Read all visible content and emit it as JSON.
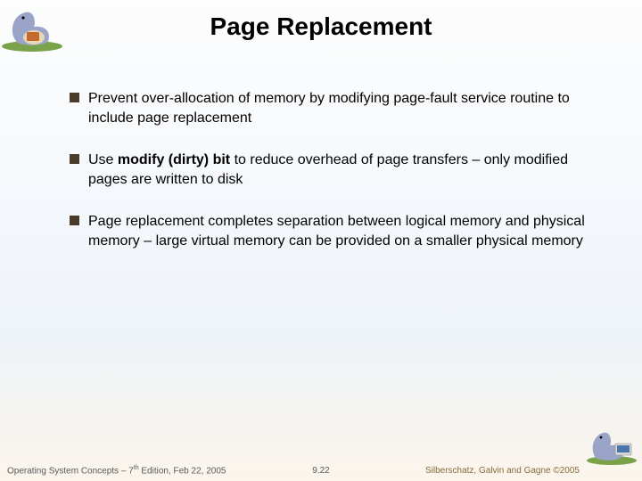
{
  "title": "Page Replacement",
  "bullets": [
    {
      "pre": "Prevent over-allocation of memory by modifying page-fault service routine to include page replacement",
      "bold": "",
      "post": ""
    },
    {
      "pre": "Use ",
      "bold": "modify (dirty) bit",
      "post": " to reduce overhead of page transfers – only modified pages are written to disk"
    },
    {
      "pre": "Page replacement completes separation between logical memory and physical memory – large virtual memory can be provided on a smaller physical memory",
      "bold": "",
      "post": ""
    }
  ],
  "footer": {
    "left_pre": "Operating System Concepts – 7",
    "left_sup": "th",
    "left_post": " Edition, Feb 22, 2005",
    "center": "9.22",
    "right": "Silberschatz, Galvin and Gagne ©2005"
  },
  "icons": {
    "tl": "dinosaur-logo",
    "br": "dinosaur-computer-logo"
  }
}
